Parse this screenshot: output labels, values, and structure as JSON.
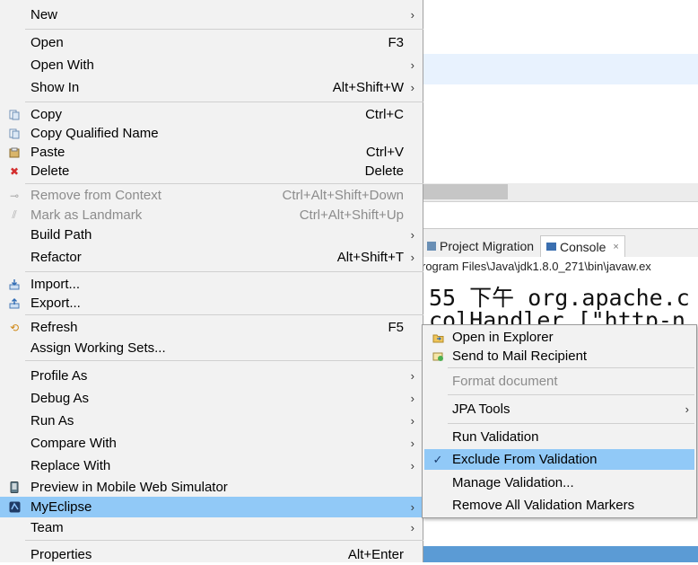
{
  "colors": {
    "menu_bg": "#f2f2f2",
    "highlight": "#91c9f7",
    "disabled_text": "#8c8c8c"
  },
  "background": {
    "tabs": [
      {
        "label": "Project Migration",
        "icon": "migration-icon"
      },
      {
        "label": "Console",
        "icon": "console-icon",
        "close": "×"
      }
    ],
    "console_path": "rogram Files\\Java\\jdk1.8.0_271\\bin\\javaw.ex",
    "console_lines": [
      "55 下午 org.apache.c",
      "colHandler [\"http-n"
    ]
  },
  "menu": {
    "items": [
      {
        "label": "New",
        "submenu": true
      },
      {
        "label": "Open",
        "shortcut": "F3"
      },
      {
        "label": "Open With",
        "submenu": true
      },
      {
        "label": "Show In",
        "shortcut": "Alt+Shift+W",
        "submenu": true
      },
      {
        "label": "Copy",
        "shortcut": "Ctrl+C",
        "icon": "copy-icon"
      },
      {
        "label": "Copy Qualified Name",
        "icon": "copy-qualified-icon"
      },
      {
        "label": "Paste",
        "shortcut": "Ctrl+V",
        "icon": "paste-icon"
      },
      {
        "label": "Delete",
        "shortcut": "Delete",
        "icon": "delete-icon"
      },
      {
        "label": "Remove from Context",
        "shortcut": "Ctrl+Alt+Shift+Down",
        "icon": "remove-context-icon",
        "disabled": true
      },
      {
        "label": "Mark as Landmark",
        "shortcut": "Ctrl+Alt+Shift+Up",
        "icon": "landmark-icon",
        "disabled": true
      },
      {
        "label": "Build Path",
        "submenu": true
      },
      {
        "label": "Refactor",
        "shortcut": "Alt+Shift+T",
        "submenu": true
      },
      {
        "label": "Import...",
        "icon": "import-icon"
      },
      {
        "label": "Export...",
        "icon": "export-icon"
      },
      {
        "label": "Refresh",
        "shortcut": "F5",
        "icon": "refresh-icon"
      },
      {
        "label": "Assign Working Sets..."
      },
      {
        "label": "Profile As",
        "submenu": true
      },
      {
        "label": "Debug As",
        "submenu": true
      },
      {
        "label": "Run As",
        "submenu": true
      },
      {
        "label": "Compare With",
        "submenu": true
      },
      {
        "label": "Replace With",
        "submenu": true
      },
      {
        "label": "Preview in Mobile Web Simulator",
        "icon": "mobile-simulator-icon"
      },
      {
        "label": "MyEclipse",
        "submenu": true,
        "icon": "myeclipse-icon",
        "selected": true
      },
      {
        "label": "Team",
        "submenu": true
      },
      {
        "label": "Properties",
        "shortcut": "Alt+Enter"
      }
    ]
  },
  "submenu": {
    "items": [
      {
        "label": "Open in Explorer",
        "icon": "explorer-icon"
      },
      {
        "label": "Send to Mail Recipient",
        "icon": "mail-icon"
      },
      {
        "label": "Format document",
        "disabled": true
      },
      {
        "label": "JPA Tools",
        "submenu": true
      },
      {
        "label": "Run Validation"
      },
      {
        "label": "Exclude From Validation",
        "checked": true,
        "selected": true
      },
      {
        "label": "Manage Validation..."
      },
      {
        "label": "Remove All Validation Markers"
      }
    ]
  },
  "glyphs": {
    "submenu_arrow": "›",
    "check": "✓"
  }
}
